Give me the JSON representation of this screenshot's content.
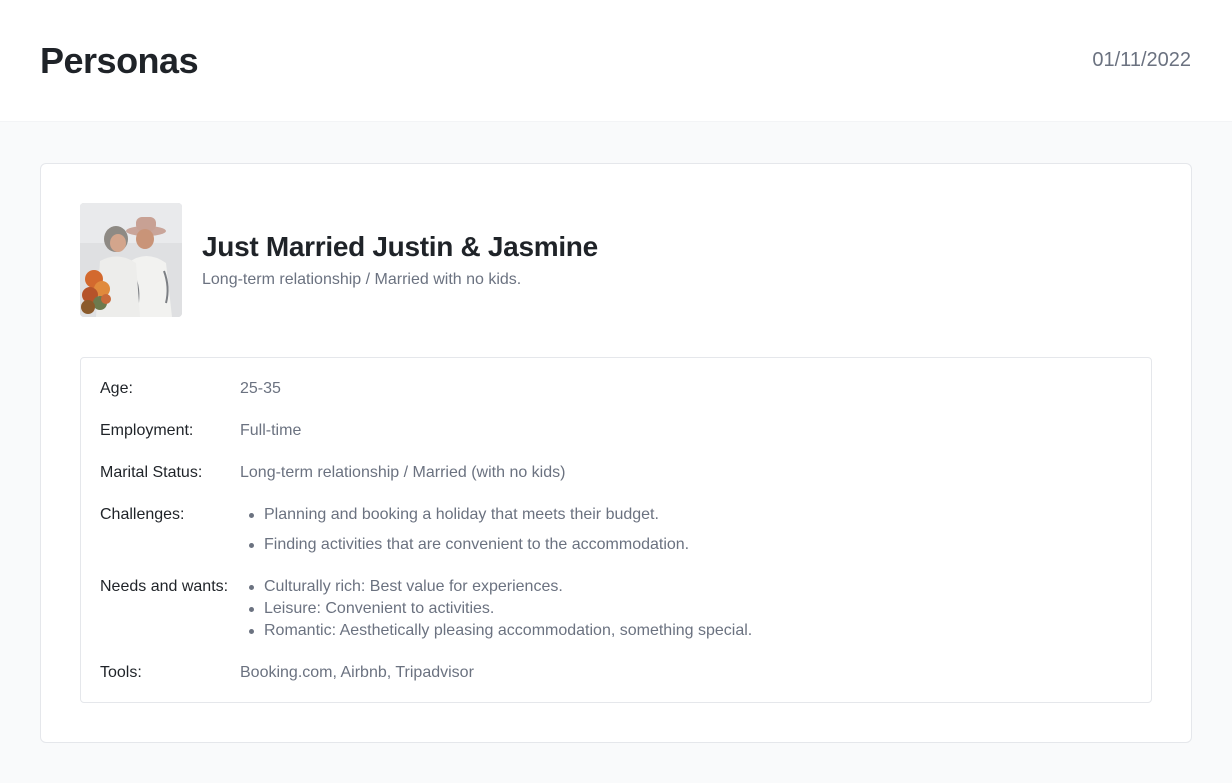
{
  "header": {
    "title": "Personas",
    "date": "01/11/2022"
  },
  "persona": {
    "name": "Just Married Justin & Jasmine",
    "subtitle": "Long-term relationship / Married with no kids.",
    "details": {
      "age": {
        "label": "Age:",
        "value": "25-35"
      },
      "employment": {
        "label": "Employment:",
        "value": "Full-time"
      },
      "marital_status": {
        "label": "Marital Status:",
        "value": "Long-term relationship / Married (with no kids)"
      },
      "challenges": {
        "label": "Challenges:",
        "items": [
          "Planning and booking a holiday that meets their budget.",
          "Finding activities that are convenient to the accommodation."
        ]
      },
      "needs": {
        "label": "Needs and wants:",
        "items": [
          "Culturally rich: Best value for experiences.",
          "Leisure: Convenient to activities.",
          "Romantic: Aesthetically pleasing accommodation, something special."
        ]
      },
      "tools": {
        "label": "Tools:",
        "value": "Booking.com, Airbnb, Tripadvisor"
      }
    }
  }
}
